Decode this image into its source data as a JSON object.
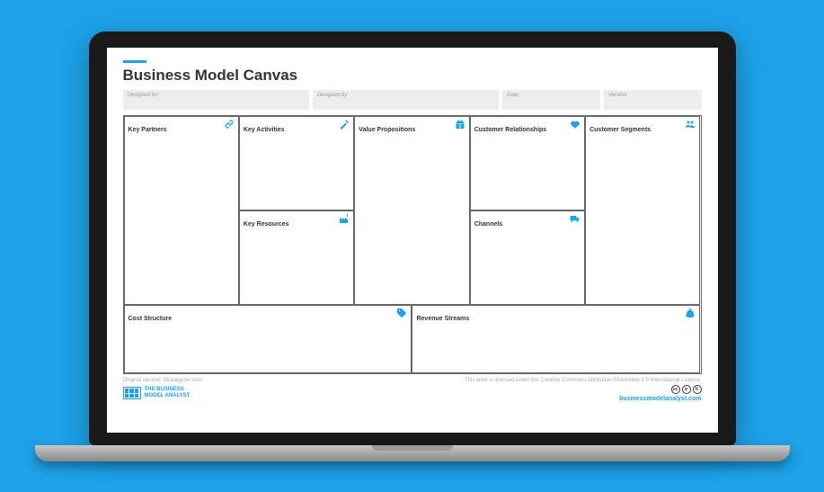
{
  "title": "Business Model Canvas",
  "meta": {
    "designed_for_label": "Designed for:",
    "designed_by_label": "Designed by:",
    "date_label": "Date:",
    "version_label": "Version:"
  },
  "cells": {
    "key_partners": "Key Partners",
    "key_activities": "Key Activities",
    "key_resources": "Key Resources",
    "value_propositions": "Value Propositions",
    "customer_relationships": "Customer Relationships",
    "channels": "Channels",
    "customer_segments": "Customer Segments",
    "cost_structure": "Cost Structure",
    "revenue_streams": "Revenue Streams"
  },
  "footer": {
    "original": "Original version: Strategyzer.com",
    "license": "This work is licensed under the Creative Commons Attribution-ShareAlike 4.0 International License.",
    "brand_line1": "THE BUSINESS",
    "brand_line2": "MODEL ANALYST",
    "website": "businessmodelanalyst.com"
  }
}
